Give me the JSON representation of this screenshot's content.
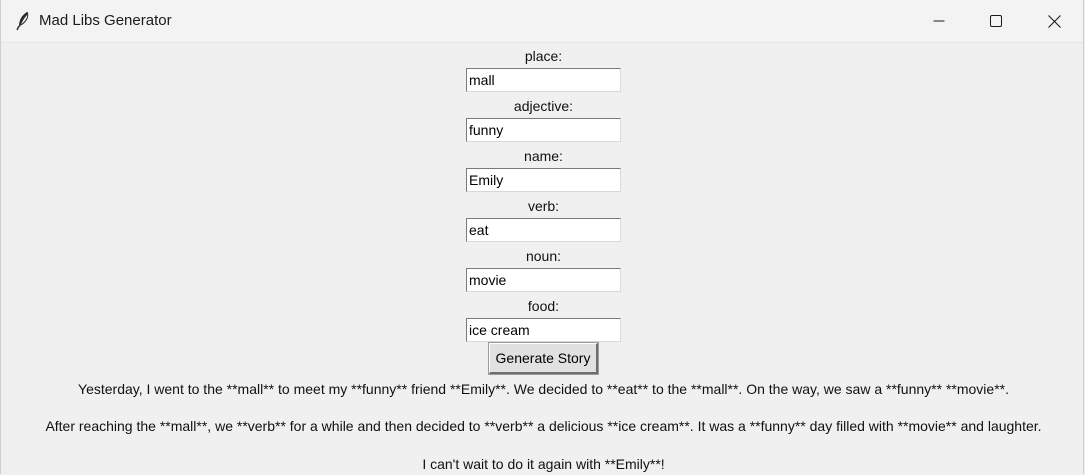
{
  "window": {
    "title": "Mad Libs Generator",
    "icon": "feather-icon"
  },
  "fields": [
    {
      "label": "place:",
      "value": "mall"
    },
    {
      "label": "adjective:",
      "value": "funny"
    },
    {
      "label": "name:",
      "value": "Emily"
    },
    {
      "label": "verb:",
      "value": "eat"
    },
    {
      "label": "noun:",
      "value": "movie"
    },
    {
      "label": "food:",
      "value": "ice cream"
    }
  ],
  "generate_label": "Generate Story",
  "story": {
    "line1": "Yesterday, I went to the **mall** to meet my **funny** friend **Emily**. We decided to **eat** to the **mall**. On the way, we saw a **funny** **movie**.",
    "line2": "After reaching the **mall**, we **verb** for a while and then decided to **verb** a delicious **ice cream**. It was a **funny** day filled with **movie** and laughter.",
    "line3": "I can't wait to do it again with **Emily**!"
  }
}
